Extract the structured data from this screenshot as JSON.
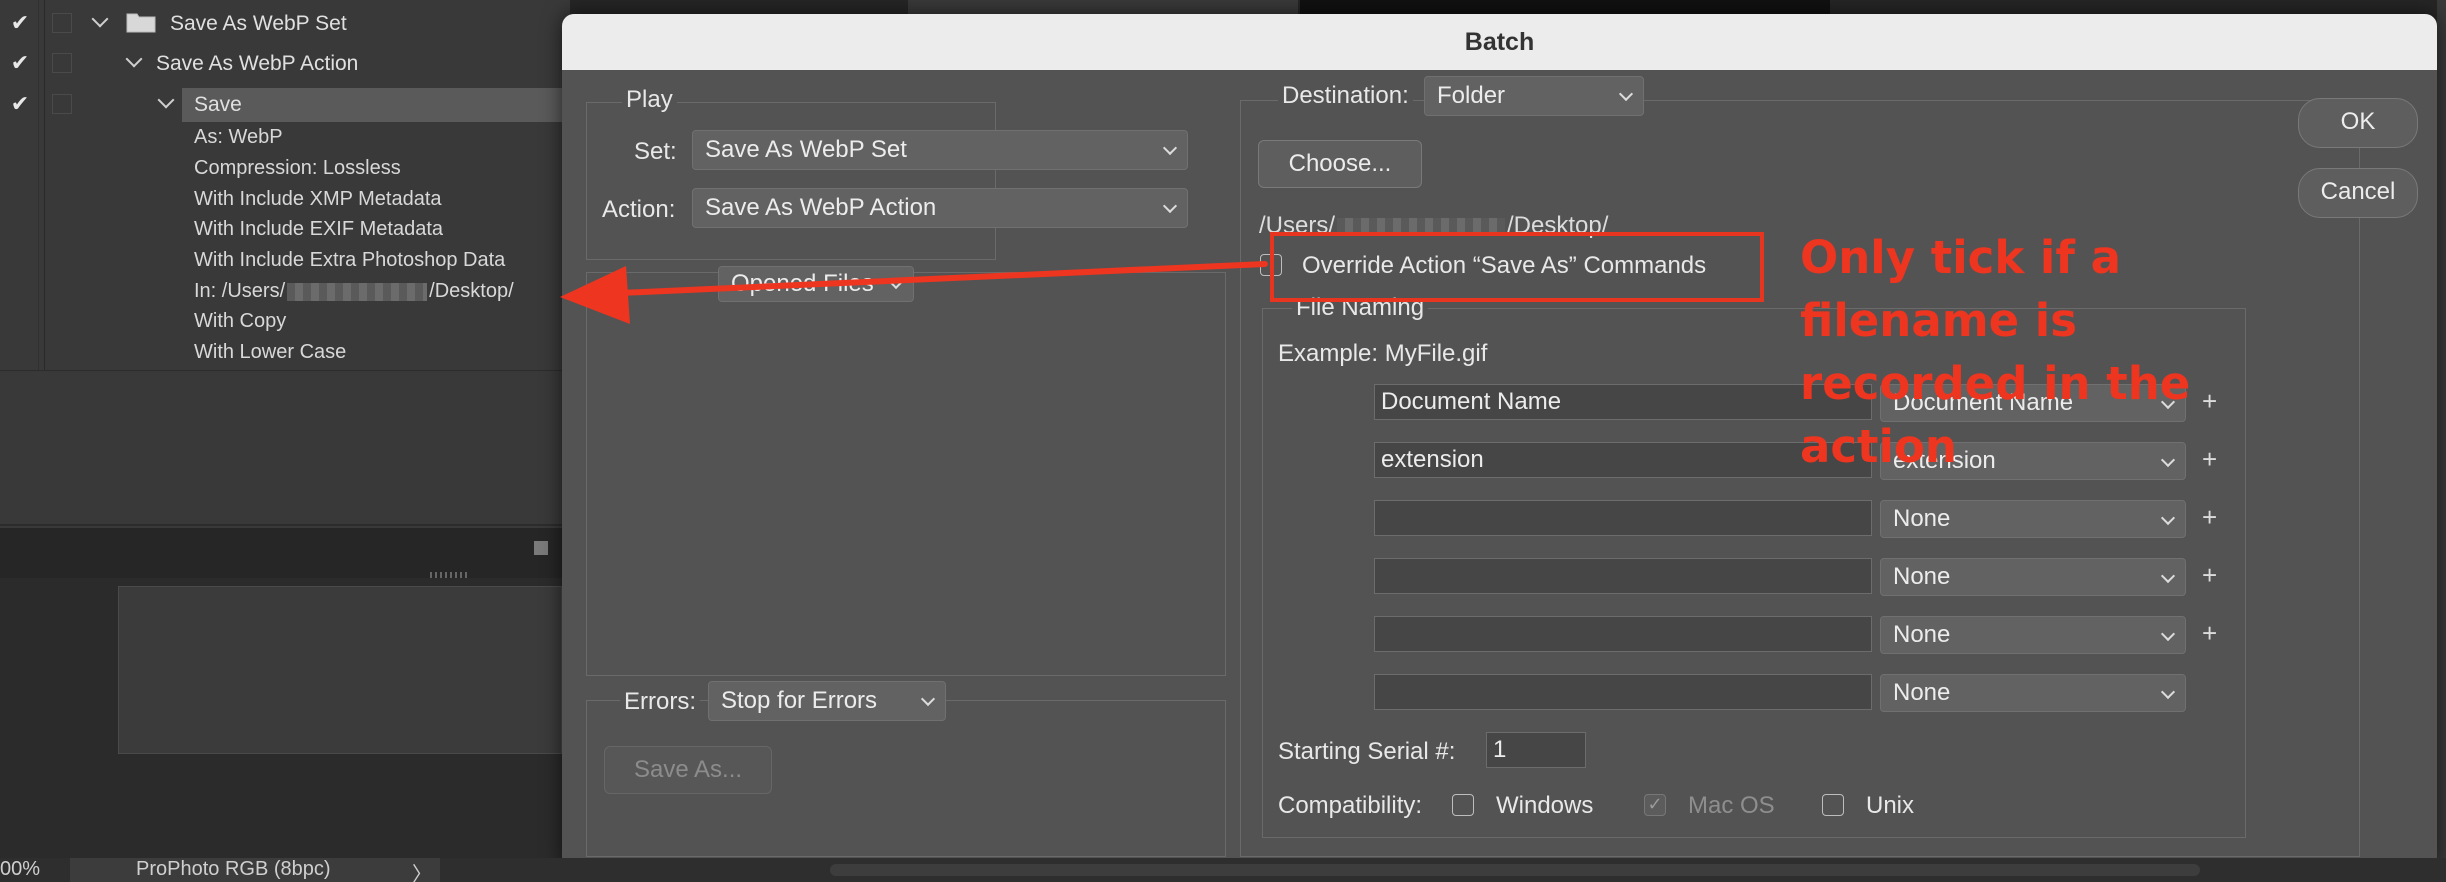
{
  "actions": {
    "rows": [
      {
        "label": "Save As WebP Set",
        "check": "✔"
      },
      {
        "label": "Save As WebP Action",
        "check": "✔"
      },
      {
        "label": "Save",
        "check": "✔"
      }
    ],
    "details": [
      "As: WebP",
      "Compression: Lossless",
      "With Include XMP Metadata",
      "With Include EXIF Metadata",
      "With Include Extra Photoshop Data",
      "With Copy",
      "With Lower Case"
    ],
    "in_prefix": "In: /Users/",
    "in_suffix": "/Desktop/"
  },
  "dialog": {
    "title": "Batch",
    "play": {
      "legend": "Play",
      "set_label": "Set:",
      "set_value": "Save As WebP Set",
      "action_label": "Action:",
      "action_value": "Save As WebP Action",
      "source_value": "Opened Files"
    },
    "errors": {
      "label": "Errors:",
      "value": "Stop for Errors",
      "save_as": "Save As..."
    },
    "destination": {
      "label": "Destination:",
      "value": "Folder",
      "choose": "Choose...",
      "path_prefix": "/Users/",
      "path_suffix": "/Desktop/",
      "override": "Override Action “Save As” Commands"
    },
    "file_naming": {
      "legend": "File Naming",
      "example": "Example: MyFile.gif",
      "rows": [
        {
          "text": "Document Name",
          "select": "Document Name"
        },
        {
          "text": "extension",
          "select": "extension"
        },
        {
          "text": "",
          "select": "None"
        },
        {
          "text": "",
          "select": "None"
        },
        {
          "text": "",
          "select": "None"
        },
        {
          "text": "",
          "select": "None"
        }
      ],
      "plus": "+",
      "serial_label": "Starting Serial #:",
      "serial_value": "1",
      "compat_label": "Compatibility:",
      "compat": [
        "Windows",
        "Mac OS",
        "Unix"
      ]
    },
    "ok": "OK",
    "cancel": "Cancel"
  },
  "statusbar": {
    "zoom": "00%",
    "profile": "ProPhoto RGB (8bpc)",
    "arrow": "〉"
  },
  "annotation": {
    "text": "Only tick if a filename is recorded in the action",
    "color": "#ee3520"
  }
}
